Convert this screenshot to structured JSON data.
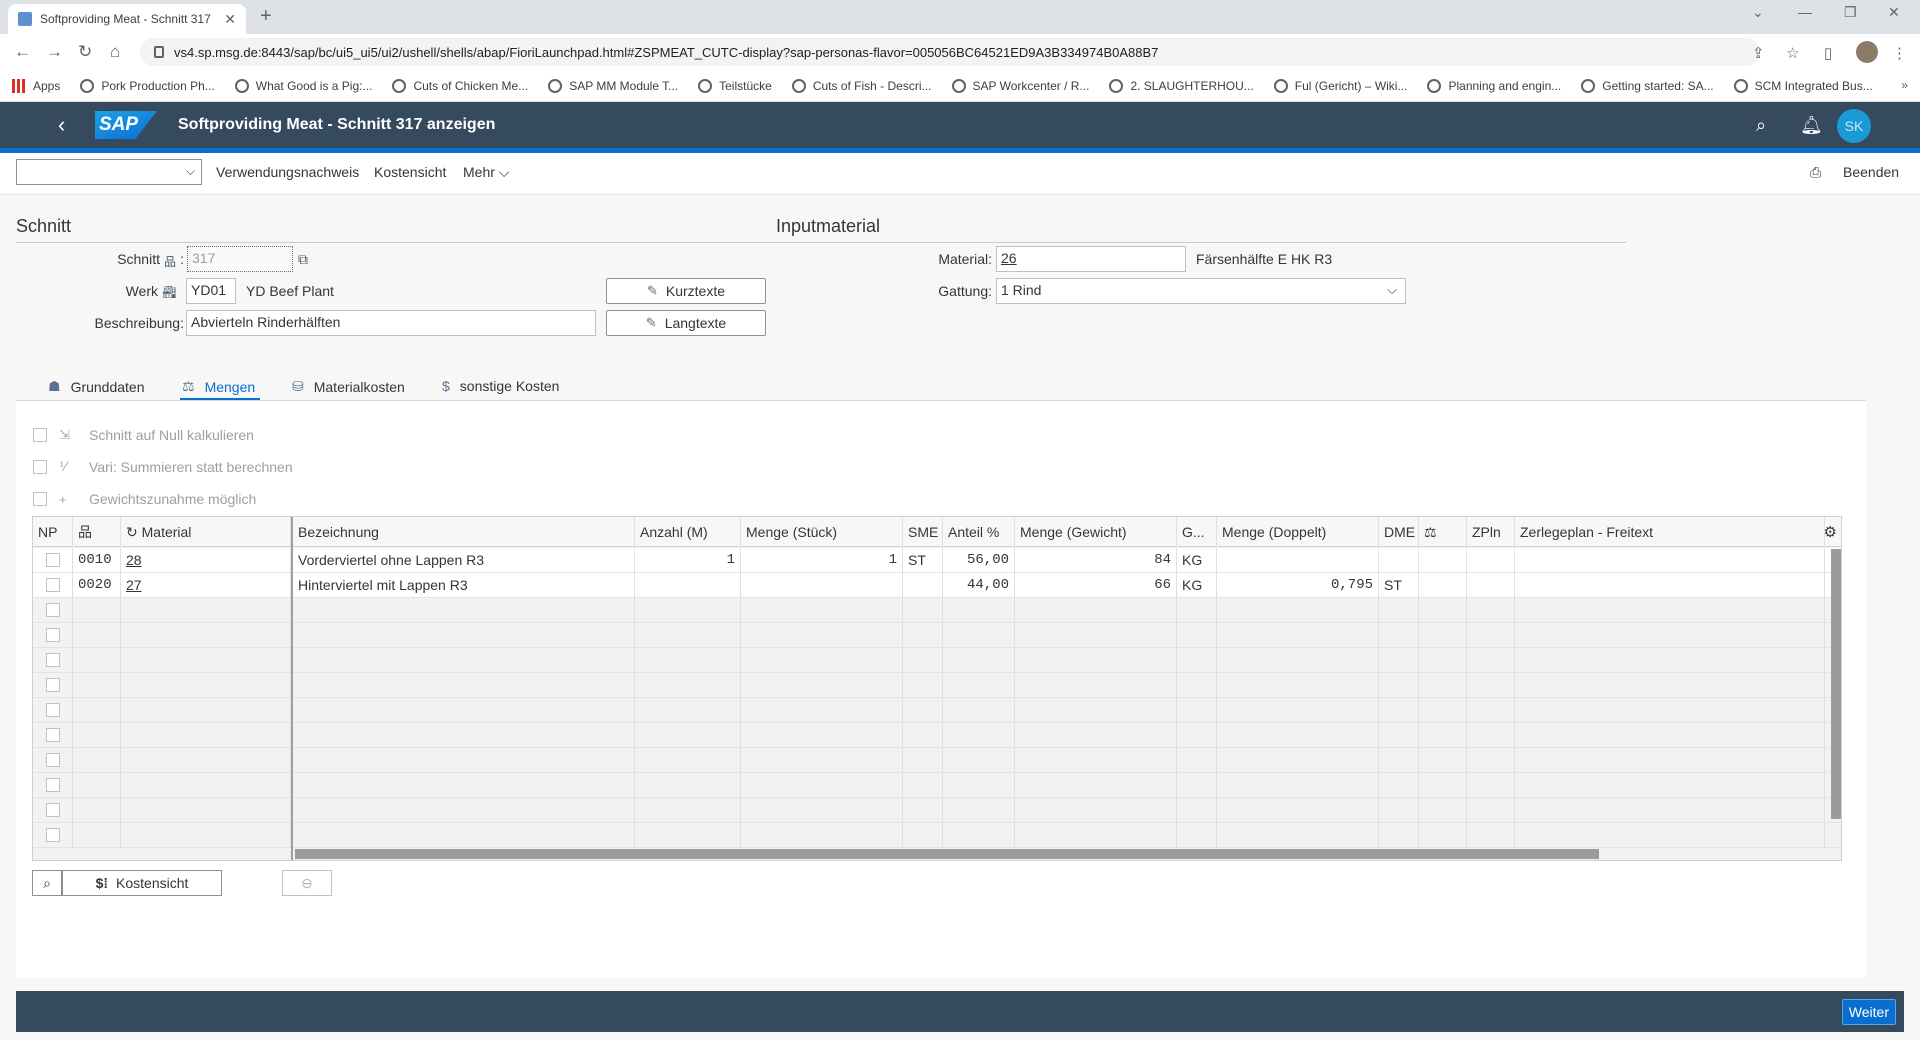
{
  "browser": {
    "tab_title": "Softproviding Meat - Schnitt 317",
    "url": "vs4.sp.msg.de:8443/sap/bc/ui5_ui5/ui2/ushell/shells/abap/FioriLaunchpad.html#ZSPMEAT_CUTC-display?sap-personas-flavor=005056BC64521ED9A3B334974B0A88B7",
    "bookmarks": [
      "Apps",
      "Pork Production Ph...",
      "What Good is a Pig:...",
      "Cuts of Chicken Me...",
      "SAP MM Module T...",
      "Teilstücke",
      "Cuts of Fish - Descri...",
      "SAP Workcenter / R...",
      "2. SLAUGHTERHOU...",
      "Ful (Gericht) – Wiki...",
      "Planning and engin...",
      "Getting started: SA...",
      "SCM Integrated Bus..."
    ]
  },
  "shell": {
    "logo": "SAP",
    "title": "Softproviding Meat - Schnitt 317 anzeigen",
    "avatar": "SK"
  },
  "toolbar": {
    "where_used": "Verwendungsnachweis",
    "cost_view": "Kostensicht",
    "more": "Mehr",
    "exit": "Beenden"
  },
  "header": {
    "section_left": "Schnitt",
    "section_right": "Inputmaterial",
    "schnitt_label": "Schnitt",
    "schnitt_value": "317",
    "werk_label": "Werk",
    "werk_value": "YD01",
    "werk_text": "YD Beef Plant",
    "beschreibung_label": "Beschreibung:",
    "beschreibung_value": "Abvierteln Rinderhälften",
    "kurztexte": "Kurztexte",
    "langtexte": "Langtexte",
    "material_label": "Material:",
    "material_value": "26",
    "material_text": "Färsenhälfte E HK R3",
    "gattung_label": "Gattung:",
    "gattung_value": "1 Rind"
  },
  "tabs": [
    "Grunddaten",
    "Mengen",
    "Materialkosten",
    "sonstige Kosten"
  ],
  "options": [
    "Schnitt auf Null kalkulieren",
    "Vari: Summieren statt berechnen",
    "Gewichtszunahme möglich"
  ],
  "table": {
    "columns": [
      "NP",
      "",
      "Material",
      "Bezeichnung",
      "Anzahl (M)",
      "Menge (Stück)",
      "SME",
      "Anteil %",
      "Menge (Gewicht)",
      "G...",
      "Menge (Doppelt)",
      "DME",
      "",
      "ZPln",
      "Zerlegeplan - Freitext"
    ],
    "rows": [
      {
        "pos": "0010",
        "material": "28",
        "bezeichnung": "Vorderviertel ohne Lappen R3",
        "anzahl": "1",
        "menge_stueck": "1",
        "sme": "ST",
        "anteil": "56,00",
        "menge_gewicht": "84",
        "g": "KG",
        "menge_doppelt": "",
        "dme": ""
      },
      {
        "pos": "0020",
        "material": "27",
        "bezeichnung": "Hinterviertel mit Lappen R3",
        "anzahl": "",
        "menge_stueck": "",
        "sme": "",
        "anteil": "44,00",
        "menge_gewicht": "66",
        "g": "KG",
        "menge_doppelt": "0,795",
        "dme": "ST"
      }
    ]
  },
  "bottom": {
    "kostensicht": "Kostensicht"
  },
  "footer": {
    "weiter": "Weiter"
  }
}
